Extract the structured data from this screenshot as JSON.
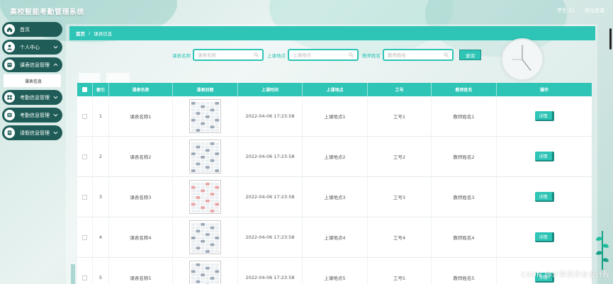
{
  "app": {
    "title": "高校智能考勤管理系统"
  },
  "user": {
    "name": "学生 11",
    "logout": "退出登录"
  },
  "sidebar": {
    "items": [
      {
        "label": "首页",
        "icon": "home-icon"
      },
      {
        "label": "个人中心",
        "icon": "user-icon"
      },
      {
        "label": "课表信息管理",
        "icon": "calendar-icon"
      },
      {
        "label": "考勤信息管理",
        "icon": "grid-icon"
      },
      {
        "label": "考勤信息管理",
        "icon": "list-icon"
      },
      {
        "label": "请假信息管理",
        "icon": "document-icon"
      }
    ],
    "sub_item": "课表信息"
  },
  "breadcrumb": {
    "home": "首页",
    "sep": "/",
    "current": "课表信息"
  },
  "search": {
    "course_label": "课表名称",
    "course_placeholder": "课表名称",
    "place_label": "上课地点",
    "place_placeholder": "上课地点",
    "teacher_label": "教师姓名",
    "teacher_placeholder": "教师姓名",
    "query_button": "查询"
  },
  "table": {
    "headers": [
      "索引",
      "课表名称",
      "课表封面",
      "上课时间",
      "上课地点",
      "工号",
      "教师姓名",
      "操作"
    ],
    "detail_label": "详情",
    "rows": [
      {
        "idx": "1",
        "name": "课表名称1",
        "time": "2022-04-06 17:23:58",
        "place": "上课地点1",
        "no": "工号1",
        "teacher": "教师姓名1"
      },
      {
        "idx": "2",
        "name": "课表名称2",
        "time": "2022-04-06 17:23:58",
        "place": "上课地点2",
        "no": "工号2",
        "teacher": "教师姓名2"
      },
      {
        "idx": "3",
        "name": "课表名称3",
        "time": "2022-04-06 17:23:58",
        "place": "上课地点3",
        "no": "工号3",
        "teacher": "教师姓名3"
      },
      {
        "idx": "4",
        "name": "课表名称4",
        "time": "2022-04-06 17:23:58",
        "place": "上课地点4",
        "no": "工号4",
        "teacher": "教师姓名4"
      },
      {
        "idx": "5",
        "name": "课表名称5",
        "time": "2022-04-06 17:23:58",
        "place": "上课地点5",
        "no": "工号5",
        "teacher": "教师姓名5"
      }
    ]
  },
  "watermark": "CSDN @计算机毕业设计程",
  "colors": {
    "accent": "#2ec4b6",
    "sidebar": "#1f5c57"
  }
}
